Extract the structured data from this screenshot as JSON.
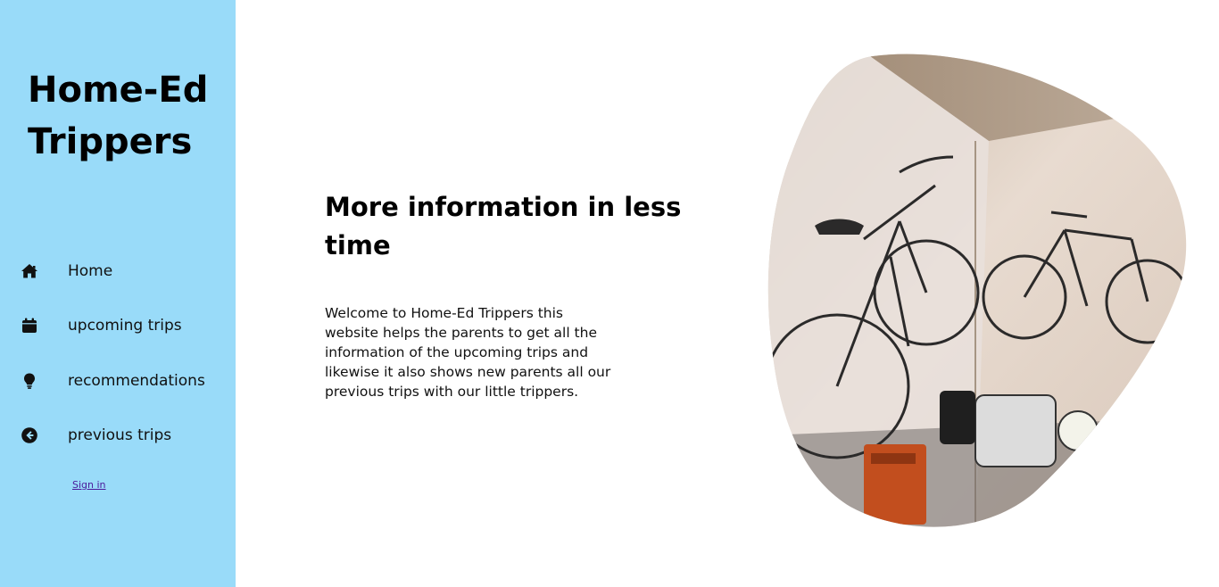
{
  "sidebar": {
    "brand_line1": "Home-Ed",
    "brand_line2": "Trippers",
    "background_color": "#99dbf9",
    "items": [
      {
        "label": "Home",
        "icon": "home-icon"
      },
      {
        "label": "upcoming trips",
        "icon": "calendar-icon"
      },
      {
        "label": "recommendations",
        "icon": "lightbulb-icon"
      },
      {
        "label": "previous trips",
        "icon": "arrow-circle-left-icon"
      }
    ],
    "signin_label": "Sign in"
  },
  "main": {
    "headline": "More information in less time",
    "intro": "Welcome to Home-Ed Trippers this website helps the parents to get all the information of the upcoming trips and likewise it also shows new parents all our previous trips with our little trippers."
  },
  "hero_image": {
    "subject": "bicycles-hanging-on-wall-photo",
    "shape": "blob"
  }
}
